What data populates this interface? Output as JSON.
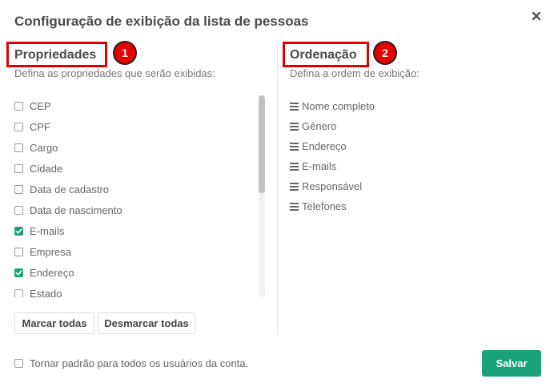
{
  "modal": {
    "title": "Configuração de exibição da lista de pessoas"
  },
  "properties": {
    "title": "Propriedades",
    "badge": "1",
    "subtitle": "Defina as propriedades que serão exibidas:",
    "items": [
      {
        "label": "CEP",
        "checked": false
      },
      {
        "label": "CPF",
        "checked": false
      },
      {
        "label": "Cargo",
        "checked": false
      },
      {
        "label": "Cidade",
        "checked": false
      },
      {
        "label": "Data de cadastro",
        "checked": false
      },
      {
        "label": "Data de nascimento",
        "checked": false
      },
      {
        "label": "E-mails",
        "checked": true
      },
      {
        "label": "Empresa",
        "checked": false
      },
      {
        "label": "Endereço",
        "checked": true
      },
      {
        "label": "Estado",
        "checked": false
      }
    ],
    "select_all_label": "Marcar todas",
    "deselect_all_label": "Desmarcar todas"
  },
  "ordering": {
    "title": "Ordenação",
    "badge": "2",
    "subtitle": "Defina a ordem de exibição:",
    "items": [
      "Nome completo",
      "Gênero",
      "Endereço",
      "E-mails",
      "Responsável",
      "Telefones"
    ]
  },
  "footer": {
    "default_label": "Tornar padrão para todos os usuários da conta.",
    "default_checked": false,
    "save_label": "Salvar"
  },
  "colors": {
    "accent": "#1aa37a",
    "highlight": "#e00000"
  },
  "icons": {
    "close": "close-icon",
    "drag": "drag-handle-icon",
    "check": "check-icon"
  }
}
